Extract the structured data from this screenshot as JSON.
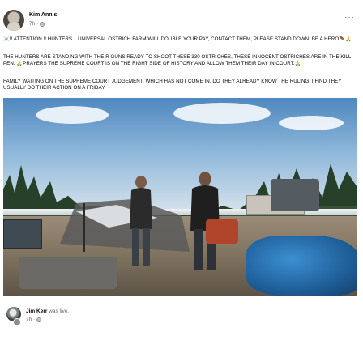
{
  "post": {
    "author": "Kim Annis",
    "time": "7h",
    "more_label": "···",
    "paragraphs": [
      "☠️!! ATTENTION !! HUNTERS .. UNIVERSAL OSTRICH FARM WILL DOUBLE YOUR PAY, CONTACT THEM, PLEASE STAND DOWN. BE A HERO🪶🙏",
      "THE HUNTERS ARE STANDING WITH THEIR GUNS READY TO SHOOT THESE 330 OSTRICHES, THESE INNOCENT OSTRICHES ARE IN THE KILL PEN. 🙏PRAYERS THE SUPREME COURT IS ON THE RIGHT SIDE OF HISTORY AND ALLOW THEM THEIR DAY IN COURT.🙏",
      "FAMILY WAITING ON THE SUPREME COURT JUDGEMENT, WHICH HAS NOT COME IN. DO THEY ALREADY KNOW THE RULING, I FIND THEY USUALLY DO THEIR ACTION ON A FRIDAY."
    ]
  },
  "shared": {
    "name": "Jim Kerr",
    "action": "was live.",
    "time": "7h"
  },
  "icons": {
    "globe": "globe-icon",
    "more": "more-options-icon",
    "live": "live-indicator-icon"
  },
  "colors": {
    "text": "#050505",
    "secondary": "#65676b"
  }
}
